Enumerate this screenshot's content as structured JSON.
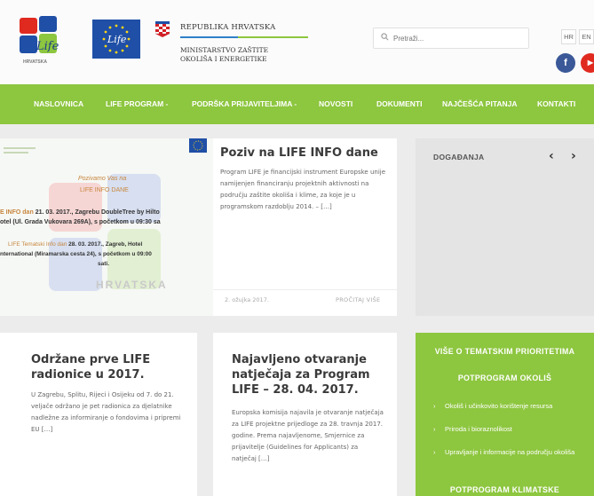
{
  "header": {
    "life_logo_text": "Life",
    "life_logo_subtext": "HRVATSKA",
    "eu_logo_text": "Life",
    "republic": "REPUBLIKA HRVATSKA",
    "ministry_line1": "MINISTARSTVO ZAŠTITE",
    "ministry_line2": "OKOLIŠA I ENERGETIKE",
    "search_placeholder": "Pretraži...",
    "lang_hr": "HR",
    "lang_en": "EN",
    "facebook_glyph": "f",
    "youtube_glyph": "▶"
  },
  "nav": {
    "items": [
      {
        "label": "NASLOVNICA"
      },
      {
        "label": "LIFE PROGRAM -"
      },
      {
        "label": "PODRŠKA PRIJAVITELJIMA -"
      },
      {
        "label": "NOVOSTI"
      },
      {
        "label": "DOKUMENTI"
      },
      {
        "label": "NAJČEŠĆA PITANJA"
      },
      {
        "label": "KONTAKTI"
      }
    ]
  },
  "featured": {
    "img_invite1": "Pozivamo Vas na",
    "img_invite2": "LIFE INFO DANE",
    "img_line1a": "E INFO dan",
    "img_line1b": "21. 03. 2017., Zagrebu DoubleTree by Hilto",
    "img_line2": "otel (Ul. Grada Vukovara 269A), s početkom u 09:30 sa",
    "img_line3a": "LIFE Tematski Info dan",
    "img_line3b": "28. 03. 2017., Zagreb, Hotel",
    "img_line4": "nternational (Miramarska cesta 24), s početkom u 09:00",
    "img_line5": "sati.",
    "img_watermark": "HRVATSKA",
    "title": "Poziv na LIFE INFO dane",
    "excerpt": "Program LIFE je financijski instrument Europske unije namijenjen financiranju projektnih aktivnosti na području zaštite okoliša i klime, za koje je u programskom razdoblju 2014. – […]",
    "date": "2. ožujka 2017.",
    "read_more": "PROČITAJ VIŠE"
  },
  "events": {
    "title": "DOGAĐANJA",
    "prev": "‹",
    "next": "›"
  },
  "card2": {
    "title_line1": "Održane prve LIFE",
    "title_line2": "radionice u 2017.",
    "excerpt": "U Zagrebu, Splitu, Rijeci i Osijeku od 7. do 21. veljače održano je pet radionica za djelatnike nadležne za informiranje o fondovima i pripremi EU […]"
  },
  "card3": {
    "title_line1": "Najavljeno otvaranje",
    "title_line2": "natječaja za Program",
    "title_line3": "LIFE – 28. 04. 2017.",
    "excerpt": "Europska komisija najavila je otvaranje natječaja za LIFE projektne prijedloge za 28. travnja 2017. godine. Prema najavljenome, Smjernice za prijavitelje (Guidelines for Applicants) za natječaj […]"
  },
  "priorities": {
    "title": "VIŠE O TEMATSKIM PRIORITETIMA",
    "subtitle1": "POTPROGRAM OKOLIŠ",
    "items": [
      {
        "label": "Okoliš i učinkovito korištenje resursa"
      },
      {
        "label": "Priroda i bioraznolikost"
      },
      {
        "label": "Upravljanje i informacije na području okoliša"
      }
    ],
    "subtitle2": "POTPROGRAM KLIMATSKE",
    "bullet": "›"
  },
  "colors": {
    "green": "#8dc63f",
    "blue": "#2f7fc8",
    "facebook": "#3b5998",
    "youtube": "#e02a20"
  }
}
